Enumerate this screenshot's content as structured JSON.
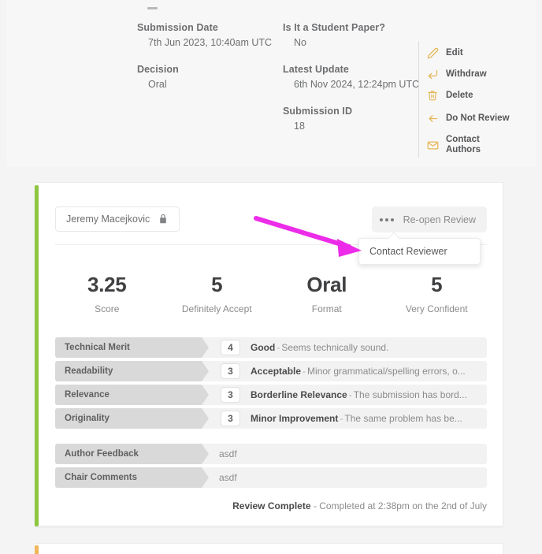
{
  "submission": {
    "fields": [
      {
        "label": "Submission Date",
        "value": "7th Jun 2023, 10:40am UTC"
      },
      {
        "label": "Decision",
        "value": "Oral"
      },
      {
        "label": "Is It a Student Paper?",
        "value": "No"
      },
      {
        "label": "Latest Update",
        "value": "6th Nov 2024, 12:24pm UTC"
      },
      {
        "label": "Submission ID",
        "value": "18"
      }
    ]
  },
  "actions": [
    {
      "label": "Edit",
      "icon": "pencil-icon"
    },
    {
      "label": "Withdraw",
      "icon": "undo-arrow-icon"
    },
    {
      "label": "Delete",
      "icon": "trash-icon"
    },
    {
      "label": "Do Not Review",
      "icon": "left-arrow-icon"
    },
    {
      "label": "Contact Authors",
      "icon": "envelope-icon"
    }
  ],
  "review": {
    "reviewer_name": "Jeremy Macejkovic",
    "lock_icon": "lock-icon",
    "more_button_icon": "ellipsis-icon",
    "reopen_label": "Re-open Review",
    "dropdown": {
      "items": [
        "Contact Reviewer"
      ]
    },
    "stats": [
      {
        "value": "3.25",
        "label": "Score"
      },
      {
        "value": "5",
        "label": "Definitely Accept"
      },
      {
        "value": "Oral",
        "label": "Format"
      },
      {
        "value": "5",
        "label": "Very Confident"
      }
    ],
    "criteria": [
      {
        "label": "Technical Merit",
        "score": "4",
        "rating": "Good",
        "comment": "Seems technically sound."
      },
      {
        "label": "Readability",
        "score": "3",
        "rating": "Acceptable",
        "comment": "Minor grammatical/spelling errors, o..."
      },
      {
        "label": "Relevance",
        "score": "3",
        "rating": "Borderline Relevance",
        "comment": "The submission has bord..."
      },
      {
        "label": "Originality",
        "score": "3",
        "rating": "Minor Improvement",
        "comment": "The same problem has be..."
      }
    ],
    "feedback": [
      {
        "label": "Author Feedback",
        "value": "asdf"
      },
      {
        "label": "Chair Comments",
        "value": "asdf"
      }
    ],
    "footer": {
      "status": "Review Complete",
      "detail": "- Completed at 2:38pm on the 2nd of July"
    },
    "accent_color": "#8dc63f"
  },
  "next_card": {
    "accent_color": "#f0b657"
  },
  "annotation": {
    "arrow_color": "#ec2ce8"
  }
}
